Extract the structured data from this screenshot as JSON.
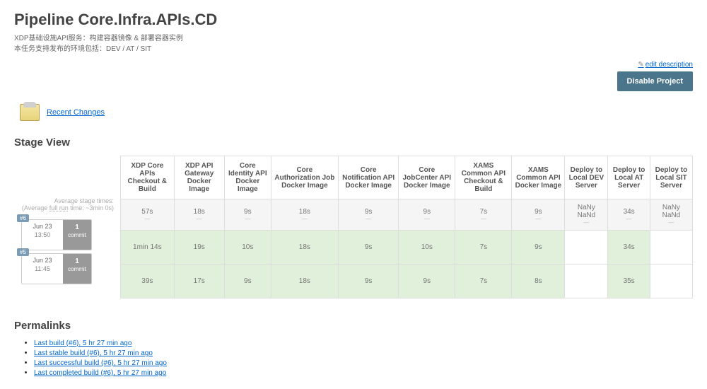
{
  "title": "Pipeline Core.Infra.APIs.CD",
  "desc1": "XDP基础设施API服务：构建容器镜像 & 部署容器实例",
  "desc2": "本任务支持发布的环境包括：DEV / AT / SIT",
  "editDescription": "edit description",
  "disableProject": "Disable Project",
  "recentChanges": "Recent Changes",
  "stageViewTitle": "Stage View",
  "avgLabel": "Average stage times:",
  "avgSub": "(Average full run time: ~3min 0s)",
  "permalinksTitle": "Permalinks",
  "stages": [
    "XDP Core APIs Checkout & Build",
    "XDP API Gateway Docker Image",
    "Core Identity API Docker Image",
    "Core Authorization Job Docker Image",
    "Core Notification API Docker Image",
    "Core JobCenter API Docker Image",
    "XAMS Common API Checkout & Build",
    "XAMS Common API Docker Image",
    "Deploy to Local DEV Server",
    "Deploy to Local AT Server",
    "Deploy to Local SIT Server"
  ],
  "avgTimes": [
    "57s",
    "18s",
    "9s",
    "18s",
    "9s",
    "9s",
    "7s",
    "9s",
    "NaNy NaNd",
    "34s",
    "NaNy NaNd"
  ],
  "runs": [
    {
      "badge": "#6",
      "date": "Jun 23",
      "time": "13:50",
      "commitCount": "1",
      "commitLabel": "commit",
      "cells": [
        "1min 14s",
        "19s",
        "10s",
        "18s",
        "9s",
        "10s",
        "7s",
        "9s",
        "",
        "34s",
        ""
      ]
    },
    {
      "badge": "#5",
      "date": "Jun 23",
      "time": "11:45",
      "commitCount": "1",
      "commitLabel": "commit",
      "cells": [
        "39s",
        "17s",
        "9s",
        "18s",
        "9s",
        "9s",
        "7s",
        "8s",
        "",
        "35s",
        ""
      ]
    }
  ],
  "permalinks": [
    "Last build (#6), 5 hr 27 min ago",
    "Last stable build (#6), 5 hr 27 min ago",
    "Last successful build (#6), 5 hr 27 min ago",
    "Last completed build (#6), 5 hr 27 min ago"
  ]
}
